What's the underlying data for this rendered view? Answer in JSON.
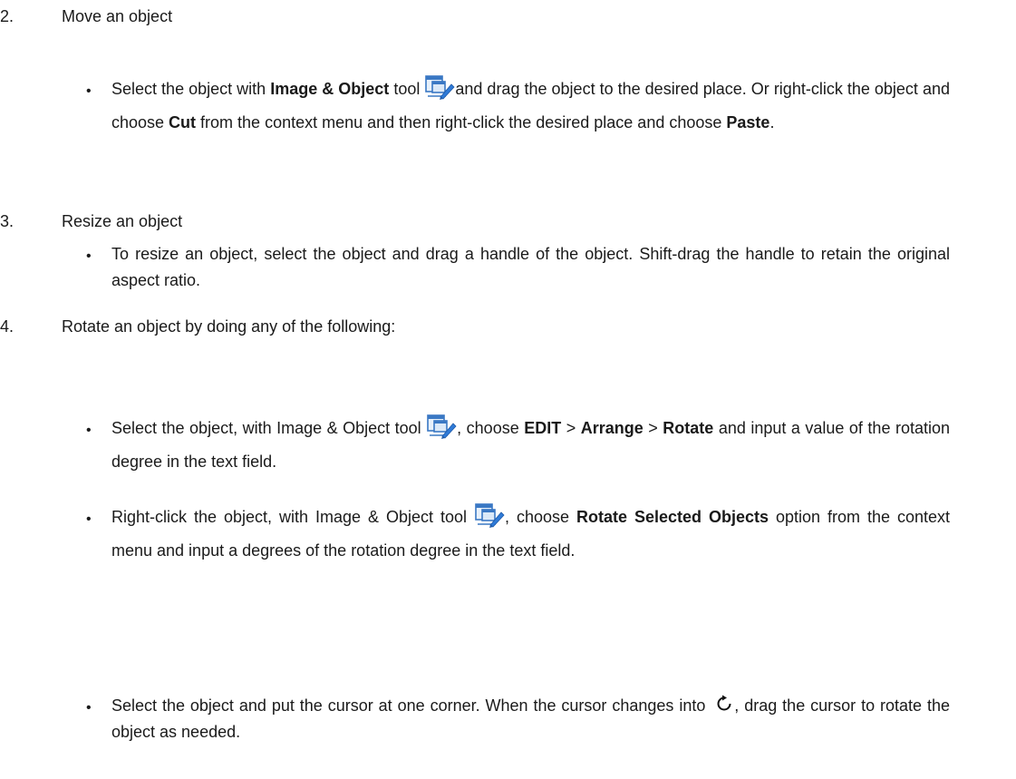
{
  "sections": {
    "move": {
      "number": "2.",
      "heading": "Move an object",
      "bullet": {
        "t1": "Select the object with ",
        "b1": "Image & Object",
        "t2": " tool ",
        "t3": "and drag the object to the desired place. Or right-click the object and choose ",
        "b2": "Cut",
        "t4": " from the context menu and then right-click the desired place and choose ",
        "b3": "Paste",
        "t5": "."
      }
    },
    "resize": {
      "number": "3.",
      "heading": "Resize an object",
      "bullet": {
        "t1": "To resize an object, select the object and drag a handle of the object. Shift-drag the handle to retain the original aspect ratio."
      }
    },
    "rotate": {
      "number": "4.",
      "heading": "Rotate an object by doing any of the following:",
      "bullet1": {
        "t1": "Select the object, with Image & Object tool ",
        "t2": ", choose ",
        "b1": "EDIT",
        "t3": " > ",
        "b2": "Arrange",
        "t4": " > ",
        "b3": "Rotate",
        "t5": " and input a value of the rotation degree in the text field."
      },
      "bullet2": {
        "t1": "Right-click the object, with Image & Object tool ",
        "t2": ", choose ",
        "b1": "Rotate Selected Objects",
        "t3": " option from the context menu and input a degrees of the rotation degree in the text field."
      },
      "bullet3": {
        "t1": "Select the object and put the cursor at one corner. When the cursor changes into ",
        "t2": ", drag the cursor to rotate the object as needed."
      }
    }
  },
  "bullet_char": "•",
  "icons": {
    "tool": "image-object-tool-icon",
    "rotate": "rotate-cursor-icon"
  }
}
